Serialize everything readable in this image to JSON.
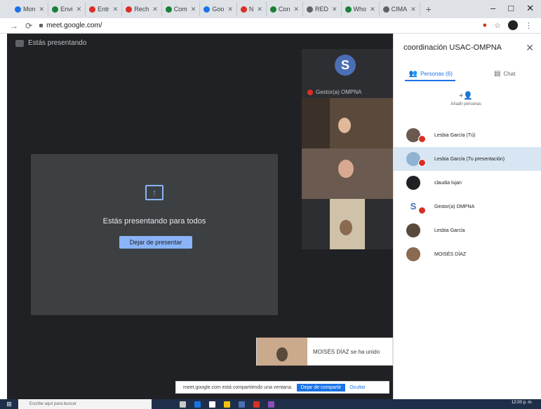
{
  "browser": {
    "tabs": [
      {
        "label": "Mon",
        "color": "#1a73e8"
      },
      {
        "label": "Envi",
        "color": "#188038"
      },
      {
        "label": "Entr",
        "color": "#d93025"
      },
      {
        "label": "Rech",
        "color": "#d93025"
      },
      {
        "label": "Com",
        "color": "#188038"
      },
      {
        "label": "Goo",
        "color": "#1a73e8"
      },
      {
        "label": "N",
        "color": "#d93025"
      },
      {
        "label": "Con",
        "color": "#188038"
      },
      {
        "label": "RED",
        "color": "#5f6368"
      },
      {
        "label": "Who",
        "color": "#188038"
      },
      {
        "label": "CIMA",
        "color": "#5f6368"
      }
    ],
    "new_tab": "+",
    "url": "meet.google.com/",
    "minimize": "–",
    "maximize": "□",
    "close": "✕"
  },
  "meet": {
    "presenting_title": "Estás presentando",
    "present_text": "Estás presentando para todos",
    "stop_button": "Dejar de presentar",
    "tiles": [
      {
        "name": "Gestor(a) OMPNA"
      }
    ],
    "toast": "MOISÉS DÍAZ se ha unido",
    "share_bar": {
      "text": "meet.google.com está compartiendo una ventana.",
      "stop": "Dejar de compartir",
      "hide": "Ocultar"
    }
  },
  "panel": {
    "title": "coordinación USAC-OMPNA",
    "people_tab": "Personas (6)",
    "chat_tab": "Chat",
    "add_people": "Añadir personas",
    "people": [
      {
        "name": "Lesbia García (Tú)"
      },
      {
        "name": "Lesbia García (Tu presentación)"
      },
      {
        "name": "claudia lujan"
      },
      {
        "name": "Gestor(a) OMPNA"
      },
      {
        "name": "Lesbia García"
      },
      {
        "name": "MOISÉS DÍAZ"
      }
    ]
  },
  "taskbar": {
    "search_placeholder": "Escribe aquí para buscar",
    "time": "12:00 p. m."
  }
}
